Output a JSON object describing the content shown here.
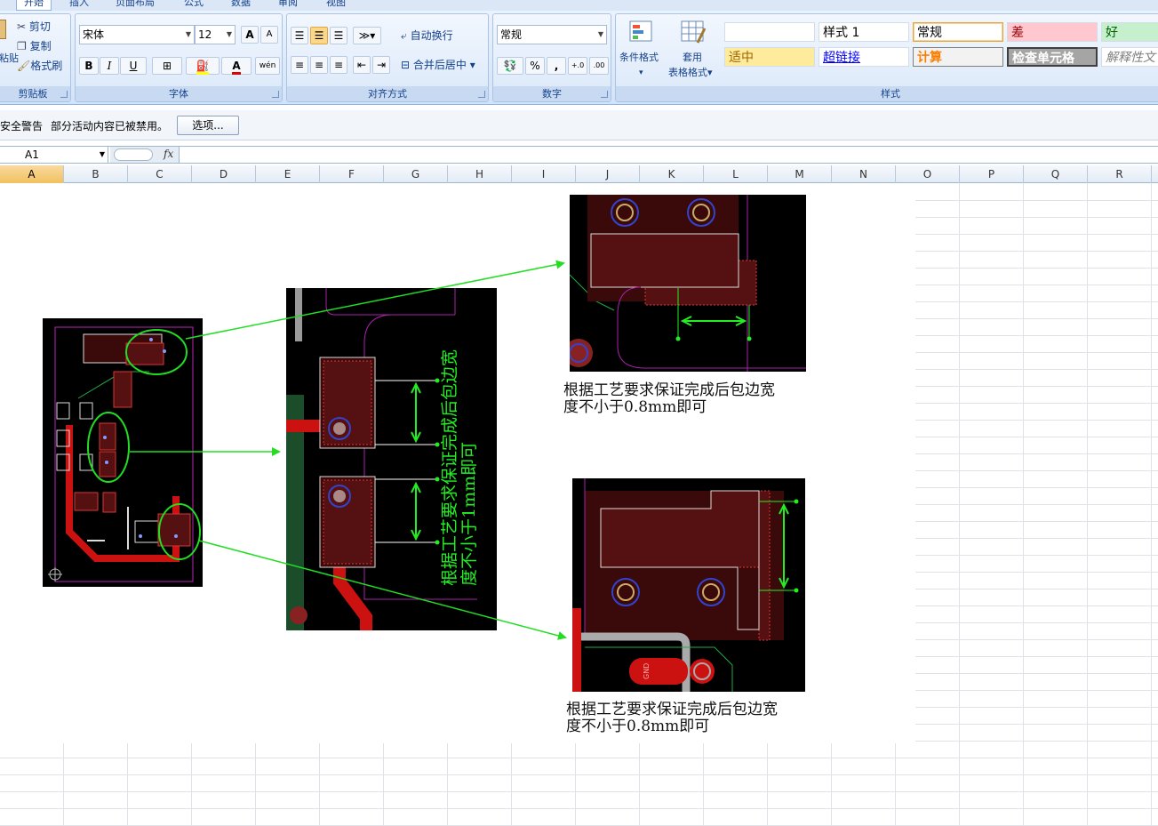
{
  "tabs": [
    "开始",
    "插入",
    "页面布局",
    "公式",
    "数据",
    "审阅",
    "视图"
  ],
  "clipboard": {
    "paste": "粘贴",
    "cut": "剪切",
    "copy": "复制",
    "format_painter": "格式刷",
    "label": "剪贴板"
  },
  "font": {
    "name": "宋体",
    "size": "12",
    "label": "字体",
    "bold": "B",
    "italic": "I",
    "underline": "U",
    "grow": "A",
    "shrink": "A",
    "phonetic": "wén"
  },
  "alignment": {
    "wrap": "自动换行",
    "merge": "合并后居中",
    "label": "对齐方式"
  },
  "number": {
    "format": "常规",
    "percent": "%",
    "comma": ",",
    "label": "数字"
  },
  "styles_group": {
    "conditional": "条件格式",
    "table_line1": "套用",
    "table_line2": "表格格式",
    "label": "样式",
    "cells": [
      {
        "text": "",
        "bg": "#ffffff",
        "fg": "#000000"
      },
      {
        "text": "样式 1",
        "bg": "#ffffff",
        "fg": "#000000"
      },
      {
        "text": "常规",
        "bg": "#ffffff",
        "fg": "#000000"
      },
      {
        "text": "差",
        "bg": "#ffc7ce",
        "fg": "#9c0006"
      },
      {
        "text": "好",
        "bg": "#c6efce",
        "fg": "#006100"
      },
      {
        "text": "适中",
        "bg": "#ffeb9c",
        "fg": "#9c6500"
      },
      {
        "text": "超链接",
        "bg": "#ffffff",
        "fg": "#0000ff"
      },
      {
        "text": "计算",
        "bg": "#f2f2f2",
        "fg": "#fa7d00"
      },
      {
        "text": "检查单元格",
        "bg": "#a5a5a5",
        "fg": "#ffffff"
      },
      {
        "text": "解释性文",
        "bg": "#ffffff",
        "fg": "#7f7f7f"
      }
    ]
  },
  "security": {
    "title": "安全警告",
    "message": "部分活动内容已被禁用。",
    "options": "选项..."
  },
  "formula_bar": {
    "name_box": "A1",
    "fx": "fx",
    "content": ""
  },
  "columns": [
    "A",
    "B",
    "C",
    "D",
    "E",
    "F",
    "G",
    "H",
    "I",
    "J",
    "K",
    "L",
    "M",
    "N",
    "O",
    "P",
    "Q",
    "R"
  ],
  "annotations": {
    "vertical_text_line1": "根据工艺要求保证完成后包边宽",
    "vertical_text_line2": "度不小于1mm即可",
    "caption_top_line1": "根据工艺要求保证完成后包边宽",
    "caption_top_line2": "度不小于0.8mm即可",
    "caption_bottom_line1": "根据工艺要求保证完成后包边宽",
    "caption_bottom_line2": "度不小于0.8mm即可",
    "gnd_label": "GND"
  },
  "colors": {
    "ribbon": "#dbe7f7",
    "selected_col": "#f1c15f",
    "arrow": "#22dd22",
    "pcb_pad": "#cc1111",
    "pcb_outline": "#bb22bb"
  }
}
